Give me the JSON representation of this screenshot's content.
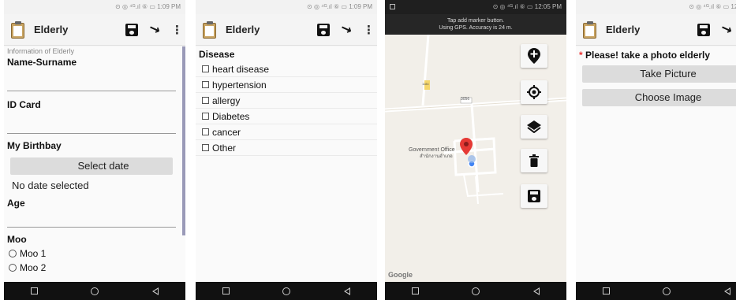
{
  "status_bar": {
    "s1": "⊙ ◎ ⁴ᴳ.ıl ⑥ ▭ 1:09 PM",
    "s2": "⊙ ◎ ⁴ᴳ.ıl ⑥ ▭ 1:09 PM",
    "s3": "⊙ ◎ ⁴ᴳ.ıl ⑥ ▭ 12:05 PM",
    "s4": "⊙ ◎ ⁴ᴳ.ıl ⑥ ▭ 12:04 P"
  },
  "app": {
    "title": "Elderly",
    "more": "⋮",
    "locate_glyph": "↘"
  },
  "screen1": {
    "section_label": "Information of Elderly",
    "name_label": "Name-Surname",
    "id_label": "ID Card",
    "birthday_label": "My Birthbay",
    "select_date": "Select date",
    "no_date": "No date selected",
    "age_label": "Age",
    "moo_label": "Moo",
    "moo_options": [
      "Moo 1",
      "Moo 2"
    ]
  },
  "screen2": {
    "disease_label": "Disease",
    "diseases": [
      "heart disease",
      "hypertension",
      "allergy",
      "Diabetes",
      "cancer",
      "Other"
    ]
  },
  "screen3": {
    "banner_line1": "Tap add marker button.",
    "banner_line2": "Using GPS. Accuracy is 24 m.",
    "place_name": "Government Office",
    "place_sub": "สำนักงานอำเภอ",
    "road_label_1": "1184",
    "road_label_2": "3056",
    "map_brand": "Google"
  },
  "screen4": {
    "star": "*",
    "prompt": " Please! take a photo elderly",
    "take_picture": "Take Picture",
    "choose_image": "Choose Image"
  }
}
